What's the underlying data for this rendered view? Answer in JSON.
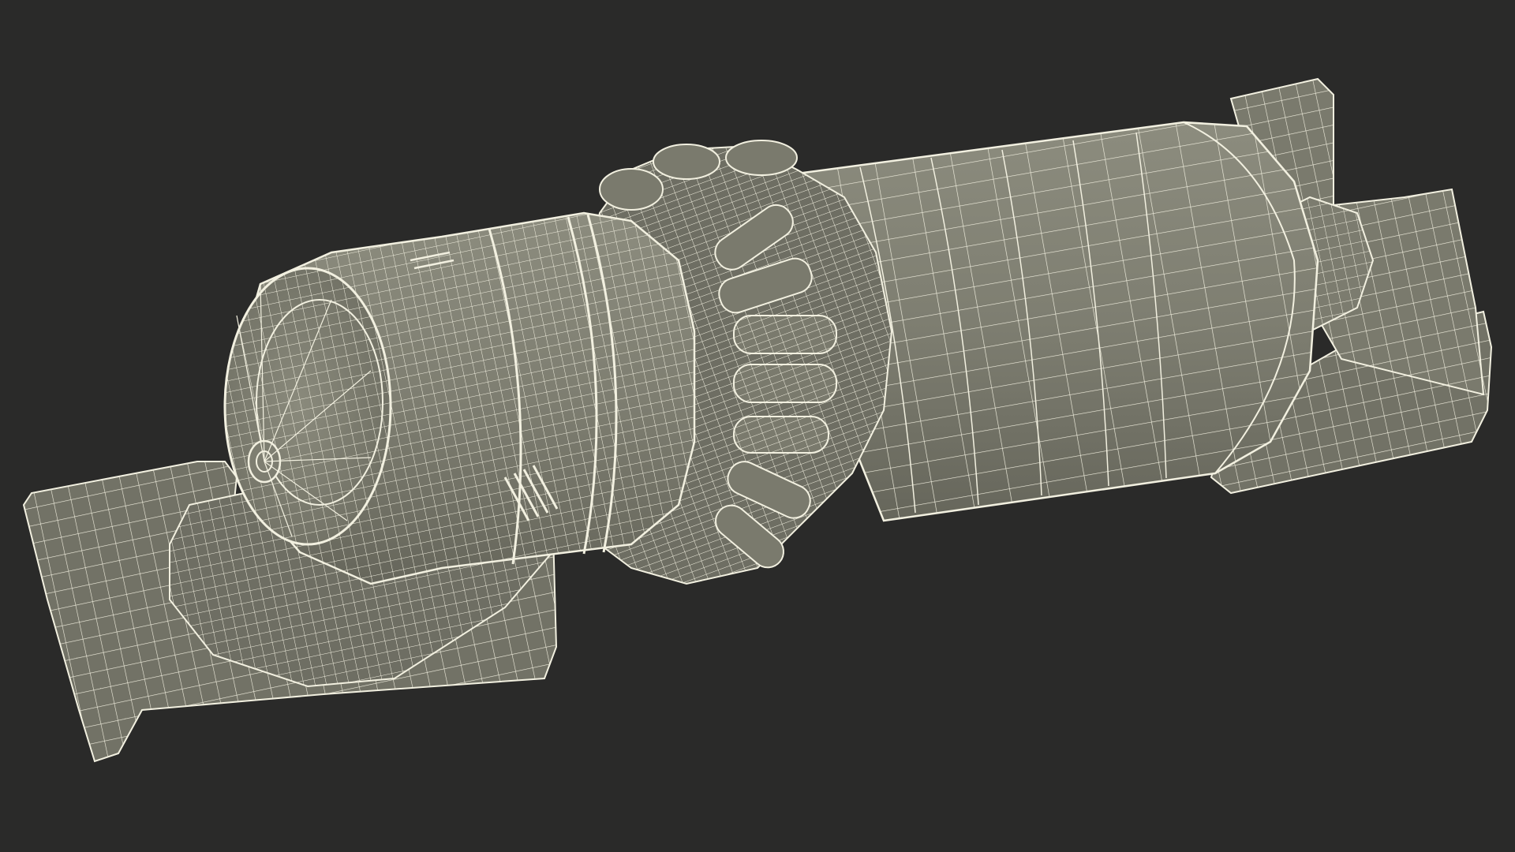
{
  "scene": {
    "background_color": "#2a2a29",
    "surface_color": "#7d7d70",
    "wire_color": "#f2f0e0",
    "shadow_color": "#55554c",
    "highlight_color": "#9a9a8c"
  }
}
